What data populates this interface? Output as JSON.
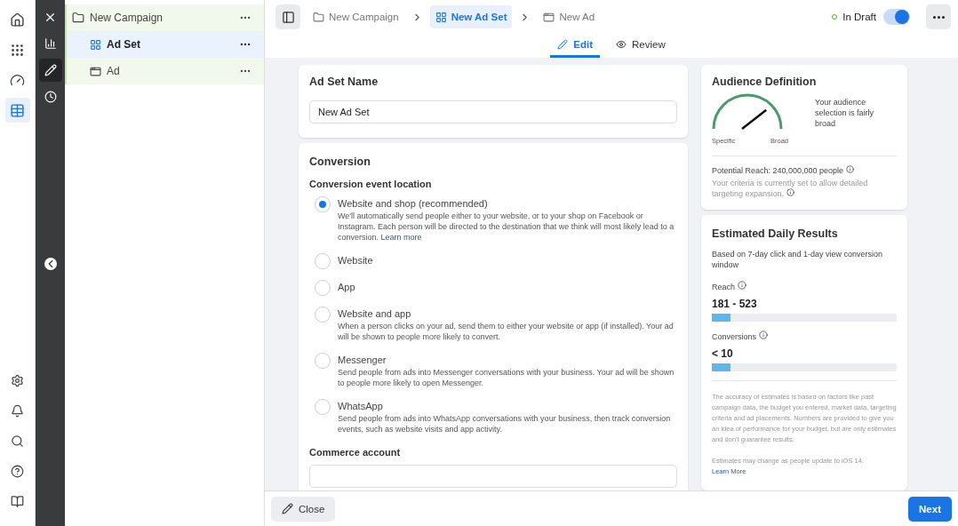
{
  "rail": {
    "items": [
      {
        "selected": false
      },
      {
        "selected": false
      },
      {
        "selected": false
      },
      {
        "selected": true
      }
    ],
    "bottom_items": [
      {
        "selected": false
      },
      {
        "selected": false
      },
      {
        "selected": false
      },
      {
        "selected": false
      },
      {
        "selected": false
      }
    ]
  },
  "tool_rail": {
    "items": [
      {
        "selected": false
      },
      {
        "selected": true
      },
      {
        "selected": false
      }
    ]
  },
  "tree": {
    "label": "New Campaign",
    "selected": false,
    "children": [
      {
        "label": "Ad Set",
        "selected": true
      },
      {
        "label": "Ad",
        "selected": false
      }
    ]
  },
  "breadcrumbs": [
    {
      "label": "New Campaign",
      "selected": false
    },
    {
      "label": "New Ad Set",
      "selected": true
    },
    {
      "label": "New Ad",
      "selected": false
    }
  ],
  "status": {
    "label": "In Draft",
    "on": true
  },
  "tabs": [
    {
      "label": "Edit",
      "selected": true
    },
    {
      "label": "Review",
      "selected": false
    }
  ],
  "ad_set_name": {
    "title": "Ad Set Name",
    "value": "New Ad Set"
  },
  "conversion": {
    "title": "Conversion",
    "subtitle": "Conversion event location",
    "options": [
      {
        "label": "Website and shop (recommended)",
        "description": "We'll automatically send people either to your website, or to your shop on Facebook or Instagram. Each person will be directed to the destination that we think will most likely lead to a conversion.",
        "link": "Learn more",
        "selected": true
      },
      {
        "label": "Website",
        "selected": false
      },
      {
        "label": "App",
        "selected": false
      },
      {
        "label": "Website and app",
        "description": "When a person clicks on your ad, send them to either your website or app (if installed). Your ad will be shown to people more likely to convert.",
        "selected": false
      },
      {
        "label": "Messenger",
        "description": "Send people from ads into Messenger conversations with your business. Your ad will be shown to people more likely to open Messenger.",
        "selected": false
      },
      {
        "label": "WhatsApp",
        "description": "Send people from ads into WhatsApp conversations with your business, then track conversion events, such as website visits and app activity.",
        "selected": false
      }
    ],
    "commerce_label": "Commerce account"
  },
  "audience": {
    "title": "Audience Definition",
    "gauge": {
      "min_label": "Specific",
      "max_label": "Broad"
    },
    "summary": "Your audience selection is fairly broad",
    "reach": "Potential Reach: 240,000,000 people",
    "note": "Your criteria is currently set to allow detailed targeting expansion."
  },
  "estimates": {
    "title": "Estimated Daily Results",
    "subtitle": "Based on 7-day click and 1-day view conversion window",
    "metrics": [
      {
        "label": "Reach",
        "value": "181 - 523",
        "level": 0.1
      },
      {
        "label": "Conversions",
        "value": "< 10",
        "level": 0.1
      }
    ],
    "disclaimer": "The accuracy of estimates is based on factors like past campaign data, the budget you entered, market data, targeting criteria and ad placements. Numbers are provided to give you an idea of performance for your budget, but are only estimates and don't guarantee results.",
    "ios_note": "Estimates may change as people update to iOS 14.",
    "ios_link": "Learn More"
  },
  "footer": {
    "close": "Close",
    "next": "Next"
  }
}
